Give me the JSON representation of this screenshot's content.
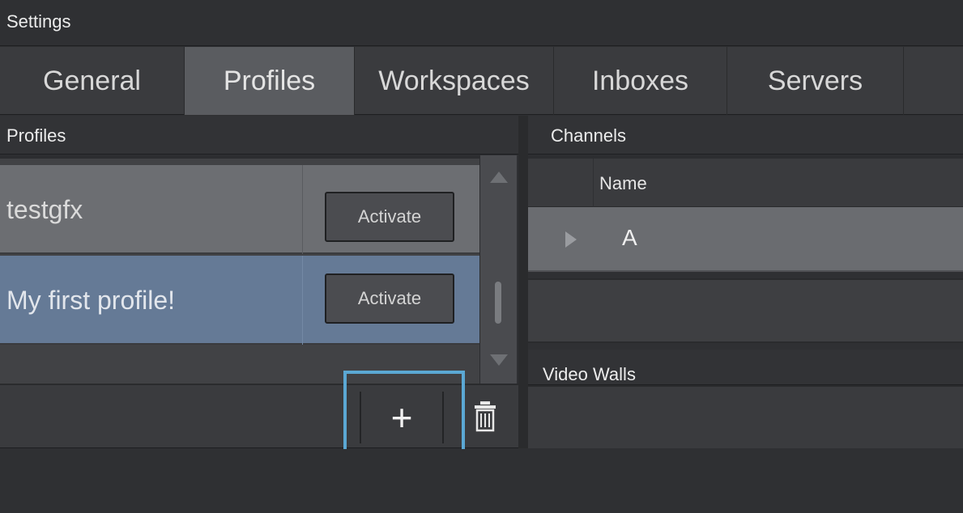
{
  "window": {
    "title": "Settings"
  },
  "tabs": [
    {
      "label": "General",
      "active": false
    },
    {
      "label": "Profiles",
      "active": true
    },
    {
      "label": "Workspaces",
      "active": false
    },
    {
      "label": "Inboxes",
      "active": false
    },
    {
      "label": "Servers",
      "active": false
    }
  ],
  "profiles_panel": {
    "title": "Profiles",
    "rows": [
      {
        "name": "testgfx",
        "action": "Activate",
        "selected": false
      },
      {
        "name": "My first profile!",
        "action": "Activate",
        "selected": true
      }
    ],
    "toolbar": {
      "add_label": "+",
      "delete_icon": "trash-icon"
    },
    "highlight_color": "#5ba8d4"
  },
  "channels_panel": {
    "title": "Channels",
    "column_header": "Name",
    "rows": [
      {
        "name": "A"
      }
    ]
  },
  "video_walls_panel": {
    "title": "Video Walls"
  },
  "colors": {
    "selected_row": "#657a96",
    "row": "#6c6e72",
    "active_tab": "#5a5c60",
    "background": "#2f3033"
  }
}
